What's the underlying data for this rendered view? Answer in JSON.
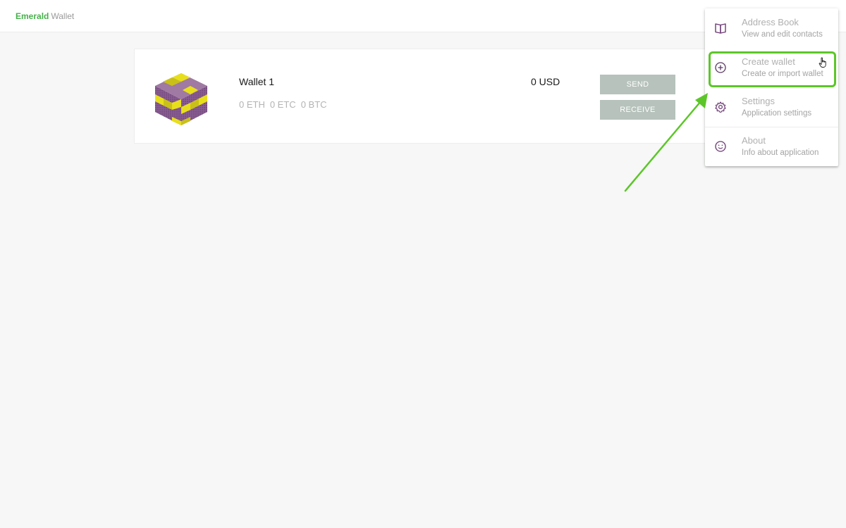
{
  "header": {
    "brand_primary": "Emerald",
    "brand_secondary": "Wallet"
  },
  "wallet": {
    "name": "Wallet 1",
    "usd_balance": "0 USD",
    "balances": [
      "0 ETH",
      "0 ETC",
      "0 BTC"
    ],
    "send_label": "SEND",
    "receive_label": "RECEIVE",
    "avatar": "identicon-cube-icon"
  },
  "menu": {
    "items": [
      {
        "title": "Address Book",
        "subtitle": "View and edit contacts",
        "icon": "book-icon"
      },
      {
        "title": "Create wallet",
        "subtitle": "Create or import wallet",
        "icon": "plus-circle-icon"
      },
      {
        "title": "Settings",
        "subtitle": "Application settings",
        "icon": "gear-icon"
      },
      {
        "title": "About",
        "subtitle": "Info about application",
        "icon": "smiley-icon"
      }
    ]
  },
  "colors": {
    "brand_green": "#47b04b",
    "button_bg": "#b6c2bb",
    "highlight_green": "#5cc628",
    "icon_purple": "#6b3a73"
  }
}
